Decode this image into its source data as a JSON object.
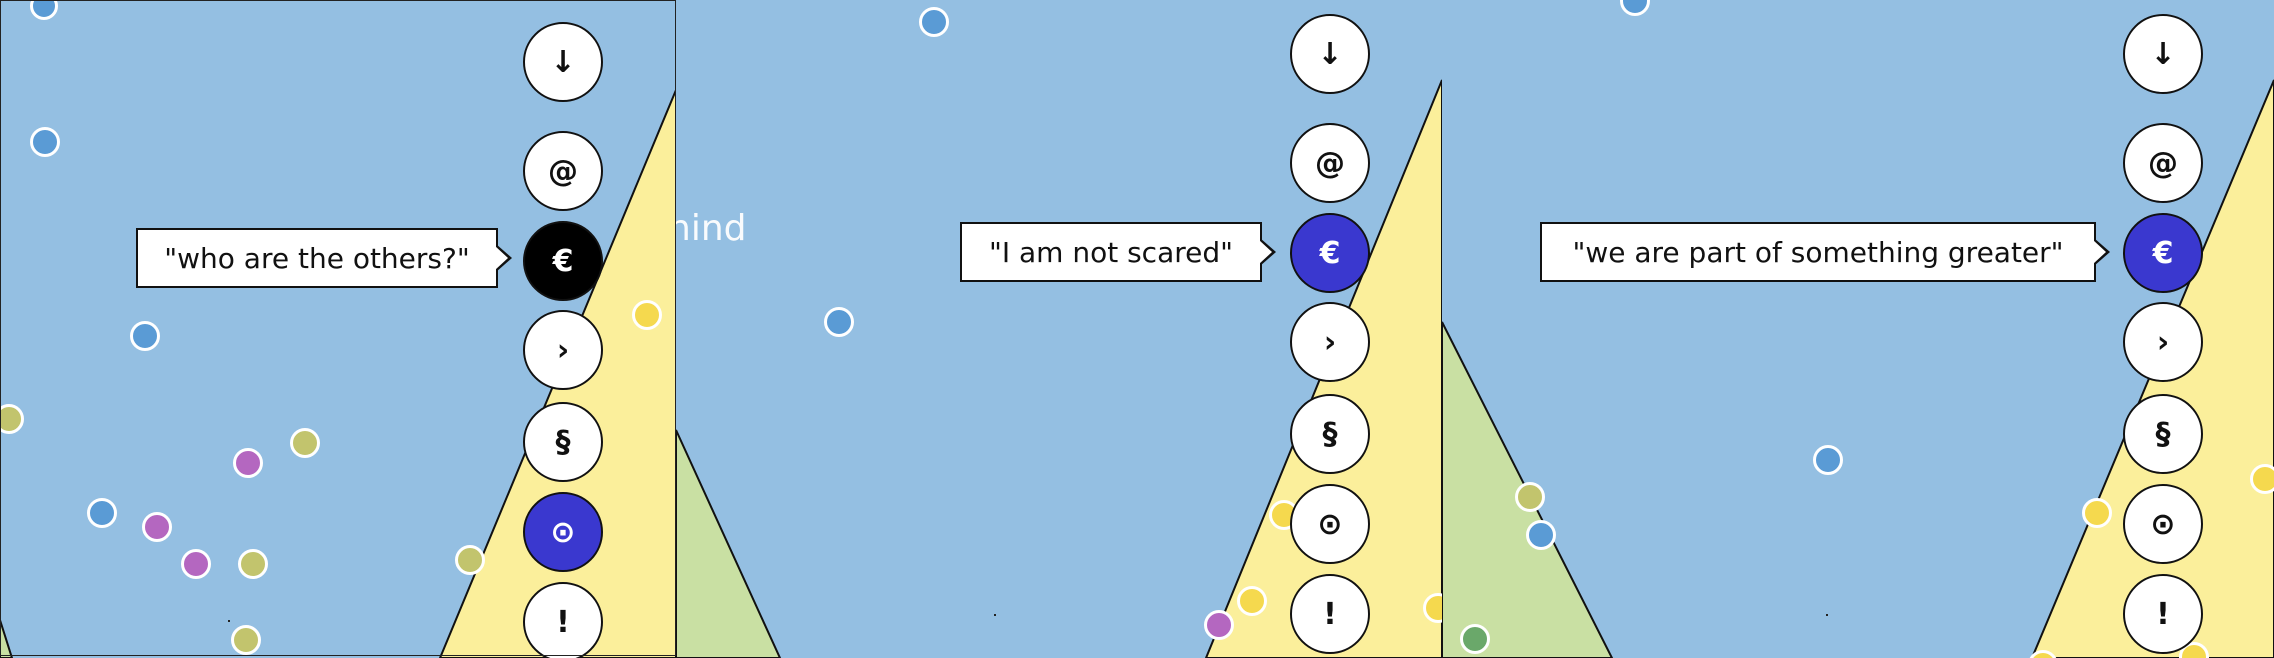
{
  "nav": {
    "buttons": [
      {
        "symbol": "↓",
        "name": "down"
      },
      {
        "symbol": "@",
        "name": "at"
      },
      {
        "symbol": "€",
        "name": "euro"
      },
      {
        "symbol": "›",
        "name": "next"
      },
      {
        "symbol": "§",
        "name": "section"
      },
      {
        "symbol": "⊙",
        "name": "target"
      },
      {
        "symbol": "!",
        "name": "exclaim"
      }
    ]
  },
  "panels": [
    {
      "tooltip": "\"who are the others?\"",
      "active_button": "euro"
    },
    {
      "tooltip": "\"I am not scared\"",
      "active_button": "euro"
    },
    {
      "tooltip": "\"we are part of something greater\"",
      "active_button": "euro"
    }
  ],
  "background_text": "nind",
  "colors": {
    "sky": "#94bfe2",
    "sand": "#fbef9b",
    "grass": "#c9e0a3",
    "accent_blue": "#3a38cf",
    "dot_blue": "#5a9bd5",
    "dot_olive": "#c2c46d",
    "dot_purple": "#b467c0",
    "dot_yellow": "#f5d94e"
  }
}
